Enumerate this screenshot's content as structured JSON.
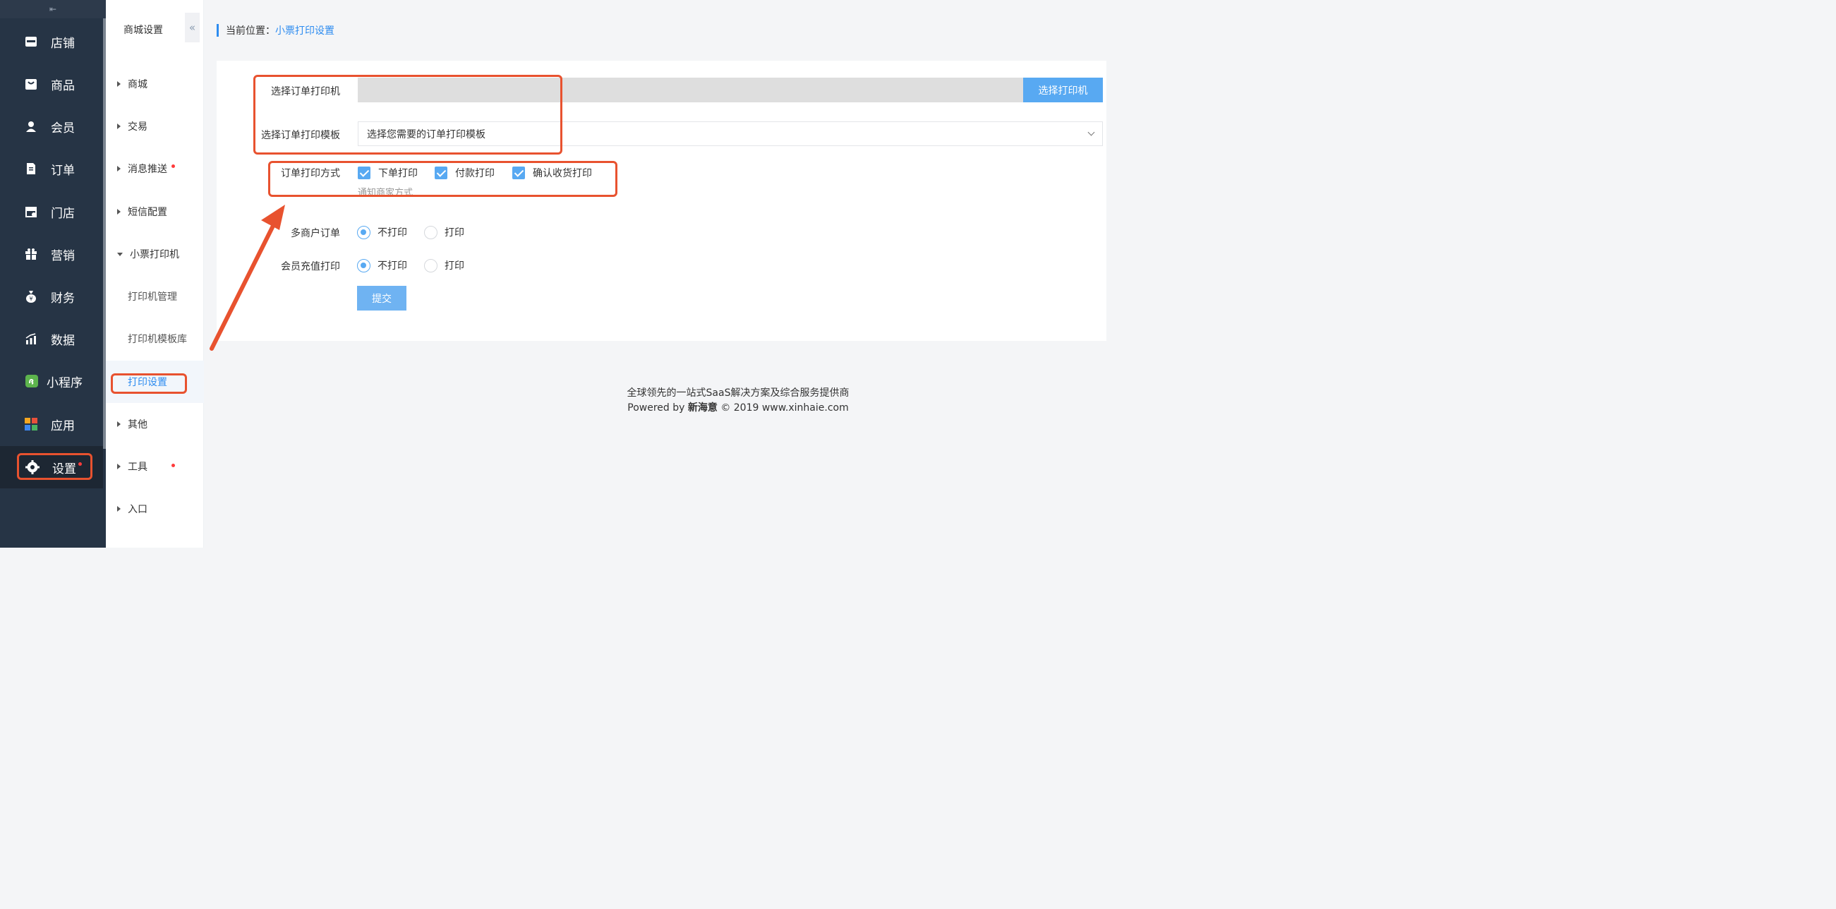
{
  "sidebar": {
    "collapse_glyph": "⇤",
    "items": [
      {
        "label": "店铺",
        "icon": "store-icon"
      },
      {
        "label": "商品",
        "icon": "shopping-bag-icon"
      },
      {
        "label": "会员",
        "icon": "user-icon"
      },
      {
        "label": "订单",
        "icon": "document-icon"
      },
      {
        "label": "门店",
        "icon": "shop-icon"
      },
      {
        "label": "营销",
        "icon": "gift-icon"
      },
      {
        "label": "财务",
        "icon": "money-bag-icon"
      },
      {
        "label": "数据",
        "icon": "bar-chart-icon"
      },
      {
        "label": "小程序",
        "icon": "mini-program-icon"
      },
      {
        "label": "应用",
        "icon": "apps-icon"
      },
      {
        "label": "设置",
        "icon": "gear-icon"
      }
    ]
  },
  "submenu": {
    "title": "商城设置",
    "fold_glyph": "«",
    "items": [
      {
        "label": "商城"
      },
      {
        "label": "交易"
      },
      {
        "label": "消息推送"
      },
      {
        "label": "短信配置"
      },
      {
        "label": "小票打印机"
      },
      {
        "label": "打印机管理"
      },
      {
        "label": "打印机模板库"
      },
      {
        "label": "打印设置"
      },
      {
        "label": "其他"
      },
      {
        "label": "工具"
      },
      {
        "label": "入口"
      }
    ]
  },
  "breadcrumb": {
    "prefix": "当前位置：",
    "current": "小票打印设置"
  },
  "form": {
    "printer_label": "选择订单打印机",
    "printer_button": "选择打印机",
    "template_label": "选择订单打印模板",
    "template_value": "选择您需要的订单打印模板",
    "method_label": "订单打印方式",
    "methods": [
      {
        "label": "下单打印",
        "checked": true
      },
      {
        "label": "付款打印",
        "checked": true
      },
      {
        "label": "确认收货打印",
        "checked": true
      }
    ],
    "method_hint": "通知商家方式",
    "multi_merchant_label": "多商户订单",
    "multi_merchant_options": [
      {
        "label": "不打印",
        "selected": true
      },
      {
        "label": "打印",
        "selected": false
      }
    ],
    "recharge_label": "会员充值打印",
    "recharge_options": [
      {
        "label": "不打印",
        "selected": true
      },
      {
        "label": "打印",
        "selected": false
      }
    ],
    "submit": "提交"
  },
  "footer": {
    "line1": "全球领先的一站式SaaS解决方案及综合服务提供商",
    "line2_prefix": "Powered by",
    "line2_brand": "新海意",
    "line2_suffix": "© 2019 www.xinhaie.com"
  },
  "colors": {
    "accent": "#58a9f2",
    "highlight": "#e8522f",
    "sidebar": "#263445"
  }
}
